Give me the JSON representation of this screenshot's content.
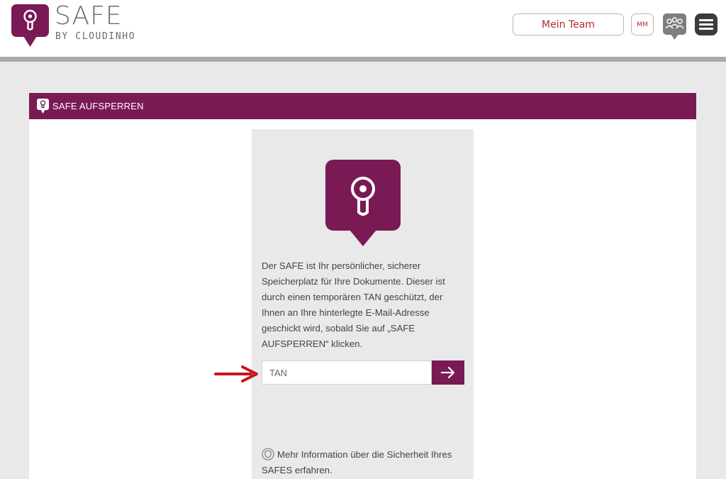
{
  "header": {
    "logo_title": "SAFE",
    "logo_subtitle": "BY CLOUDINHO",
    "team_button_label": "Mein Team",
    "user_initials": "MM",
    "team_icon": "group-chat-icon",
    "menu_icon": "hamburger-icon"
  },
  "panel": {
    "title": "SAFE AUFSPERREN",
    "icon": "keyhole-icon"
  },
  "card": {
    "icon": "keyhole-icon",
    "description": "Der SAFE ist Ihr persönlicher, sicherer Speicherplatz für Ihre Dokumente. Dieser ist durch einen temporären TAN geschützt, der Ihnen an Ihre hinterlegte E-Mail-Adresse geschickt wird, sobald Sie auf „SAFE AUFSPERREN“ klicken.",
    "tan_placeholder": "TAN",
    "tan_value": "",
    "submit_icon": "arrow-right-icon",
    "info_icon": "shield-icon",
    "info_link": "Mehr Information über die Sicherheit Ihres SAFES erfahren."
  },
  "annotation": {
    "arrow_icon": "red-arrow-icon"
  },
  "colors": {
    "brand": "#7a1a55",
    "accent_text": "#b22a2a",
    "header_rule": "#a9a9a9",
    "page_bg": "#e9e9e9"
  }
}
